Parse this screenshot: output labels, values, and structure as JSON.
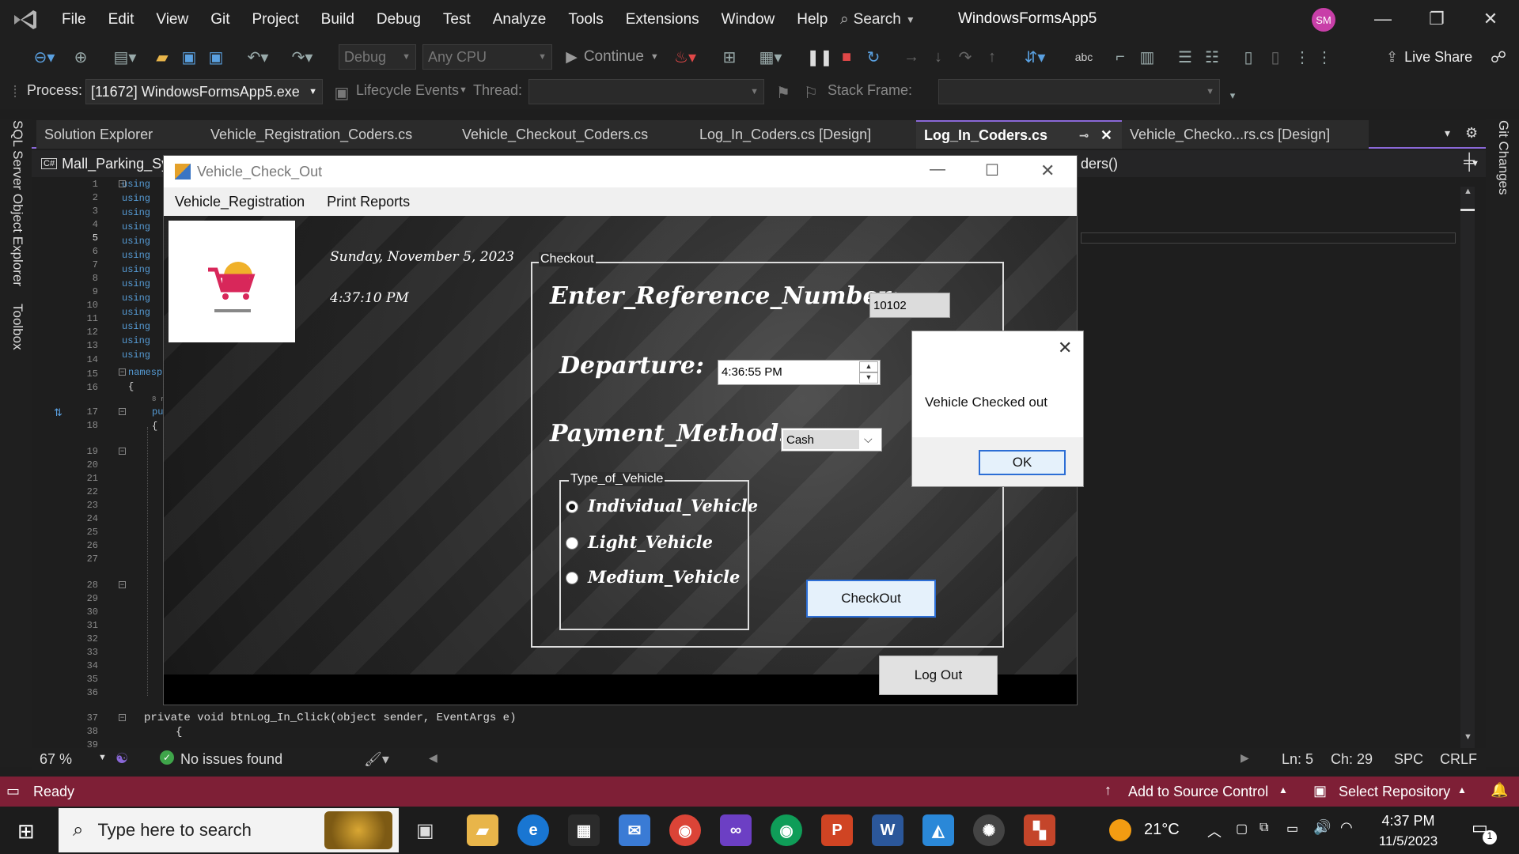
{
  "ide": {
    "menu": [
      "File",
      "Edit",
      "View",
      "Git",
      "Project",
      "Build",
      "Debug",
      "Test",
      "Analyze",
      "Tools",
      "Extensions",
      "Window",
      "Help"
    ],
    "search_label": "Search",
    "solution_name": "WindowsFormsApp5",
    "avatar_initials": "SM",
    "toolbar": {
      "config": "Debug",
      "platform": "Any CPU",
      "continue_label": "Continue",
      "live_share": "Live Share"
    },
    "debug_location": {
      "process_label": "Process:",
      "process_value": "[11672] WindowsFormsApp5.exe",
      "lifecycle_label": "Lifecycle Events",
      "thread_label": "Thread:",
      "stack_frame_label": "Stack Frame:"
    },
    "side_left": [
      "SQL Server Object Explorer",
      "Toolbox"
    ],
    "side_right": [
      "Git Changes"
    ],
    "tabs": [
      {
        "label": "Solution Explorer",
        "active": false
      },
      {
        "label": "Vehicle_Registration_Coders.cs",
        "active": false
      },
      {
        "label": "Vehicle_Checkout_Coders.cs",
        "active": false
      },
      {
        "label": "Log_In_Coders.cs [Design]",
        "active": false
      },
      {
        "label": "Log_In_Coders.cs",
        "active": true
      },
      {
        "label": "Vehicle_Checko...rs.cs [Design]",
        "active": false
      }
    ],
    "nav_project": "Mall_Parking_Sys",
    "nav_member": "ders()",
    "line_numbers": [
      "1",
      "2",
      "3",
      "4",
      "5",
      "6",
      "7",
      "8",
      "9",
      "10",
      "11",
      "12",
      "13",
      "14",
      "15",
      "16",
      "17",
      "18",
      "19",
      "20",
      "21",
      "22",
      "23",
      "24",
      "25",
      "26",
      "27",
      "28",
      "29",
      "30",
      "31",
      "32",
      "33",
      "34",
      "35",
      "36",
      "37",
      "38",
      "39"
    ],
    "code_keywords": [
      "using",
      "using",
      "using",
      "using",
      "using",
      "using",
      "using",
      "using",
      "using",
      "using",
      "using",
      "using",
      "using"
    ],
    "namespace_kw": "namesp",
    "brace_open": "{",
    "references_hint": "8 r",
    "public_kw": "pu",
    "code_line_37": "private void btnLog_In_Click(object sender, EventArgs e)",
    "code_line_38": "{",
    "editor_status": {
      "zoom": "67 %",
      "issues": "No issues found",
      "ln": "Ln: 5",
      "ch": "Ch: 29",
      "spc": "SPC",
      "crlf": "CRLF"
    },
    "status": {
      "ready": "Ready",
      "source_control": "Add to Source Control",
      "repository": "Select Repository"
    }
  },
  "app": {
    "title": "Vehicle_Check_Out",
    "menu": [
      "Vehicle_Registration",
      "Print Reports"
    ],
    "date": "Sunday, November 5, 2023",
    "time": "4:37:10 PM",
    "checkout_group": "Checkout",
    "ref_label": "Enter_Reference_Number:",
    "ref_value": "10102",
    "departure_label": "Departure:",
    "departure_value": "4:36:55 PM",
    "payment_label": "Payment_Method:",
    "payment_value": "Cash",
    "type_group": "Type_of_Vehicle",
    "vehicle_types": [
      {
        "label": "Individual_Vehicle",
        "selected": true
      },
      {
        "label": "Light_Vehicle",
        "selected": false
      },
      {
        "label": "Medium_Vehicle",
        "selected": false
      }
    ],
    "checkout_button": "CheckOut",
    "logout_button": "Log Out"
  },
  "dialog": {
    "message": "Vehicle Checked out",
    "ok_button": "OK"
  },
  "taskbar": {
    "search_placeholder": "Type here to search",
    "weather": "21°C",
    "time": "4:37 PM",
    "date": "11/5/2023",
    "notification_count": "1"
  },
  "colors": {
    "accent": "#8a68d8",
    "status_bar": "#7e1f36",
    "code_keyword": "#569cd6"
  }
}
